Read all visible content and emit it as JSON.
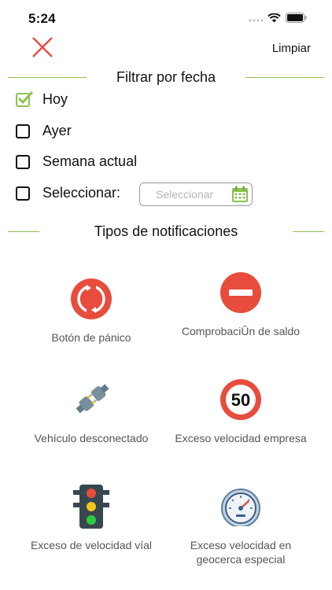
{
  "status_bar": {
    "time": "5:24"
  },
  "header": {
    "clear_label": "Limpiar",
    "close_icon": "close-icon"
  },
  "date_filter": {
    "title": "Filtrar por fecha",
    "options": [
      {
        "label": "Hoy",
        "checked": true
      },
      {
        "label": "Ayer",
        "checked": false
      },
      {
        "label": "Semana actual",
        "checked": false
      },
      {
        "label": "Seleccionar:",
        "checked": false
      }
    ],
    "date_input": {
      "placeholder": "Seleccionar",
      "icon": "calendar-icon"
    }
  },
  "notification_types": {
    "title": "Tipos de notificaciones",
    "items": [
      {
        "label": "Botón de pánico",
        "icon": "panic-button-icon"
      },
      {
        "label": "ComprobaciÛn de saldo",
        "icon": "no-entry-icon"
      },
      {
        "label": "Vehículo desconectado",
        "icon": "unplugged-icon"
      },
      {
        "label": "Exceso velocidad empresa",
        "icon": "speed-limit-icon",
        "speed": "50"
      },
      {
        "label": "Exceso de velocidad víal",
        "icon": "traffic-light-icon"
      },
      {
        "label": "Exceso velocidad en geocerca especial",
        "icon": "speedometer-icon"
      }
    ]
  },
  "colors": {
    "accent_green": "#8cc152",
    "red": "#e84c3d",
    "checkbox_check": "#8cc152"
  }
}
